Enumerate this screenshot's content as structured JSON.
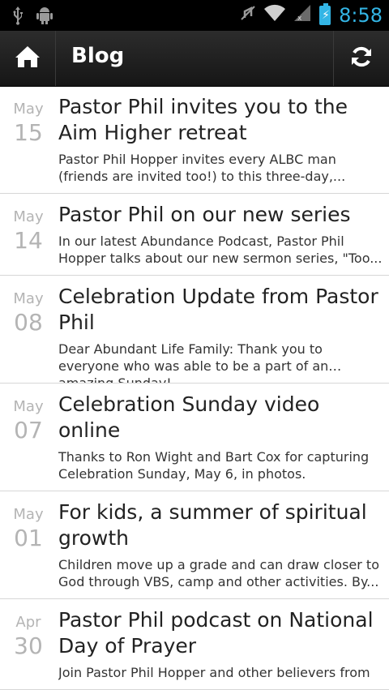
{
  "status_bar": {
    "time": "8:58",
    "icons": [
      "usb-icon",
      "android-debug-icon",
      "mute-icon",
      "wifi-icon",
      "signal-icon",
      "battery-charging-icon"
    ]
  },
  "action_bar": {
    "title": "Blog",
    "home_icon": "home-icon",
    "refresh_icon": "refresh-icon"
  },
  "posts": [
    {
      "month": "May",
      "day": "15",
      "title": "Pastor Phil invites you to the Aim Higher retreat",
      "excerpt": "Pastor Phil Hopper invites every ALBC man (friends are invited too!) to this three-day,..."
    },
    {
      "month": "May",
      "day": "14",
      "title": "Pastor Phil on our new series",
      "excerpt": "In our latest Abundance Podcast, Pastor Phil Hopper talks about our new sermon series, \"Too..."
    },
    {
      "month": "May",
      "day": "08",
      "title": "Celebration Update from Pastor Phil",
      "excerpt": "Dear Abundant Life Family: Thank you to everyone who was able to be a part of an amazing Sunday!..."
    },
    {
      "month": "May",
      "day": "07",
      "title": "Celebration Sunday video online",
      "excerpt": "Thanks to Ron Wight and Bart Cox for capturing Celebration Sunday, May 6, in photos."
    },
    {
      "month": "May",
      "day": "01",
      "title": "For kids, a summer of spiritual growth",
      "excerpt": "Children move up a grade and can draw closer to God through VBS, camp and other activities. By..."
    },
    {
      "month": "Apr",
      "day": "30",
      "title": "Pastor Phil podcast on National Day of Prayer",
      "excerpt": "Join Pastor Phil Hopper and other believers from"
    }
  ]
}
